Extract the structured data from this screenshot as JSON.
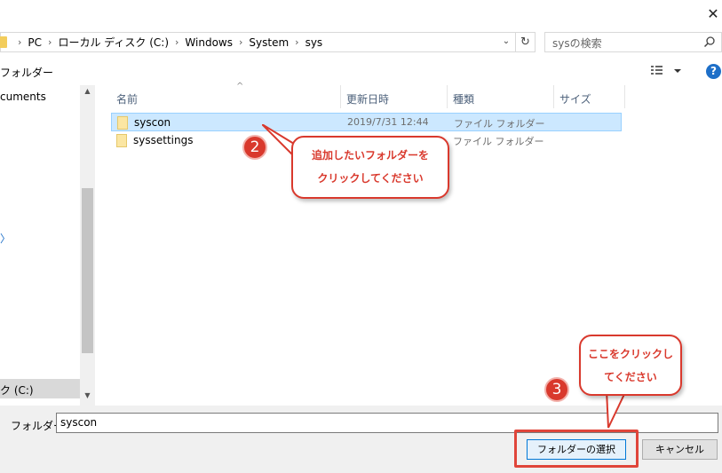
{
  "window": {
    "close_glyph": "✕"
  },
  "address_bar": {
    "crumbs": [
      "PC",
      "ローカル ディスク (C:)",
      "Windows",
      "System",
      "sys"
    ],
    "separator": "›",
    "dropdown_glyph": "⌄",
    "refresh_glyph": "↻"
  },
  "search": {
    "placeholder": "sysの検索",
    "icon": "search-icon"
  },
  "toolbar": {
    "new_folder_label": "フォルダー",
    "view_icon": "details-view-icon",
    "help_glyph": "?"
  },
  "nav": {
    "items": [
      {
        "label": "cuments"
      },
      {
        "label": "ク (C:)"
      }
    ],
    "partial_glyph": "〉"
  },
  "columns": [
    {
      "label": "名前"
    },
    {
      "label": "更新日時"
    },
    {
      "label": "種類"
    },
    {
      "label": "サイズ"
    }
  ],
  "files": [
    {
      "name": "syscon",
      "date": "2019/7/31 12:44",
      "type": "ファイル フォルダー",
      "selected": true
    },
    {
      "name": "syssettings",
      "date": "",
      "type": "ファイル フォルダー",
      "selected": false
    }
  ],
  "bottom": {
    "folder_label": "フォルダー:",
    "folder_value": "syscon",
    "select_button": "フォルダーの選択",
    "cancel_button": "キャンセル"
  },
  "annotations": {
    "step2": {
      "number": "2",
      "lines": [
        "追加したいフォルダーを",
        "クリックしてください"
      ]
    },
    "step3": {
      "number": "3",
      "lines": [
        "ここをクリックし",
        "てください"
      ]
    },
    "accent_color": "#d9392d"
  }
}
